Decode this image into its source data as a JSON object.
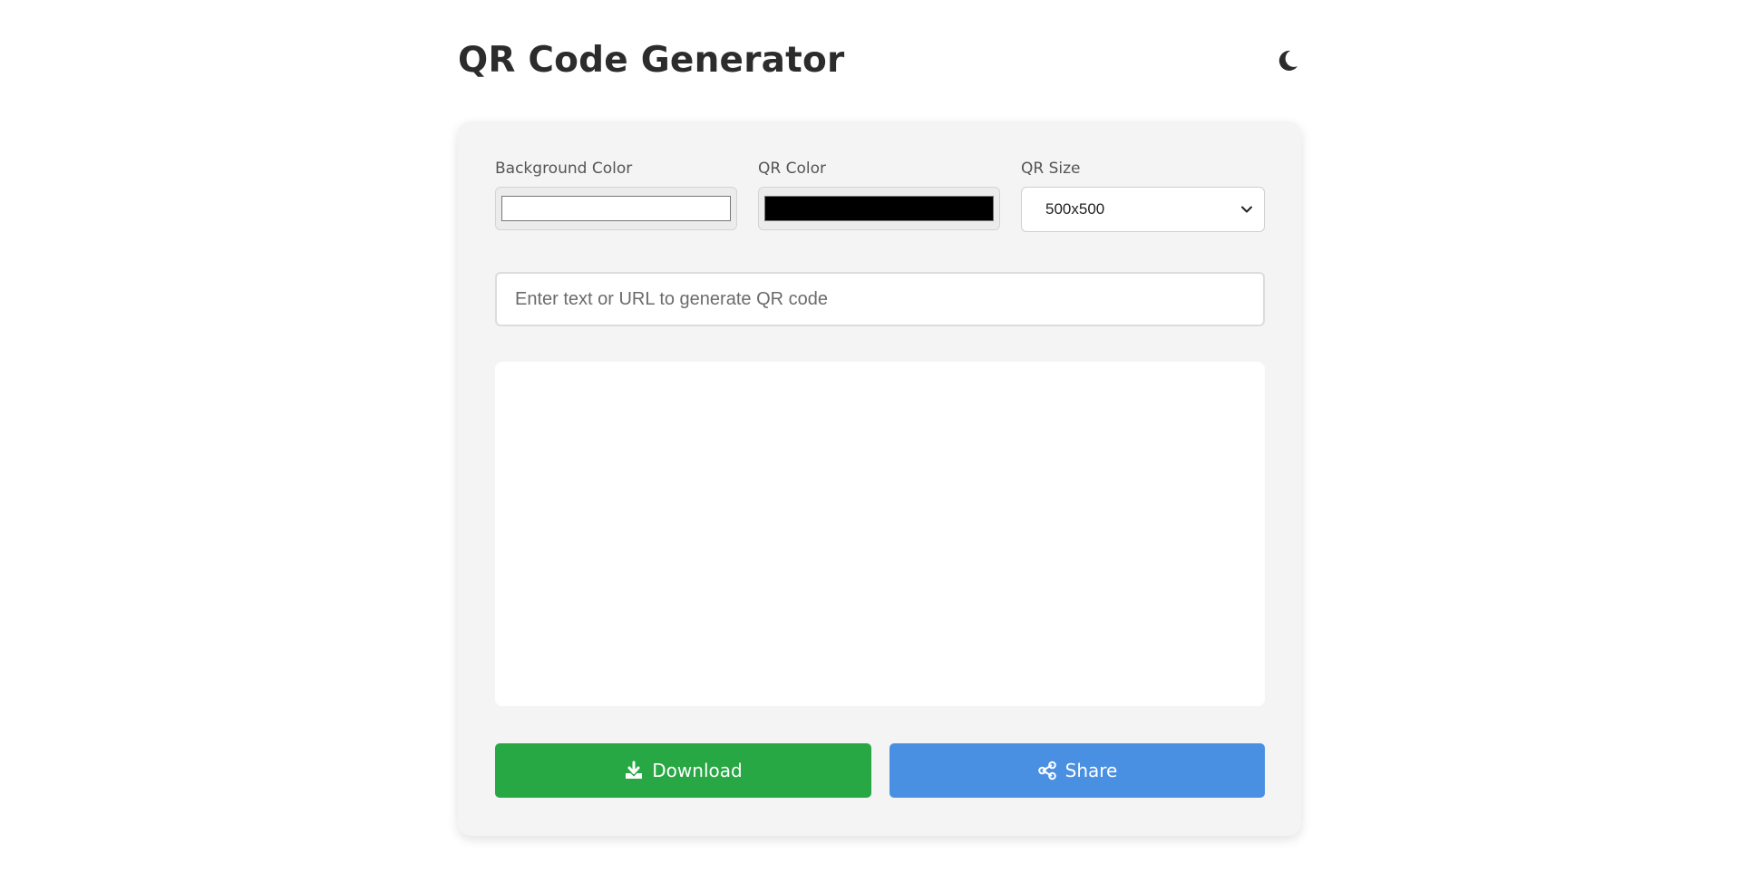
{
  "header": {
    "title": "QR Code Generator",
    "theme_toggle_icon": "moon-icon"
  },
  "controls": {
    "background_color": {
      "label": "Background Color",
      "value": "#ffffff"
    },
    "qr_color": {
      "label": "QR Color",
      "value": "#000000"
    },
    "qr_size": {
      "label": "QR Size",
      "selected": "500x500",
      "chevron_icon": "chevron-down-icon"
    }
  },
  "input": {
    "value": "",
    "placeholder": "Enter text or URL to generate QR code"
  },
  "actions": {
    "download": {
      "label": "Download",
      "icon": "download-icon",
      "color": "#28a745"
    },
    "share": {
      "label": "Share",
      "icon": "share-icon",
      "color": "#4a90e2"
    }
  },
  "theme": {
    "card_background": "#f4f4f4",
    "page_background": "#ffffff"
  }
}
